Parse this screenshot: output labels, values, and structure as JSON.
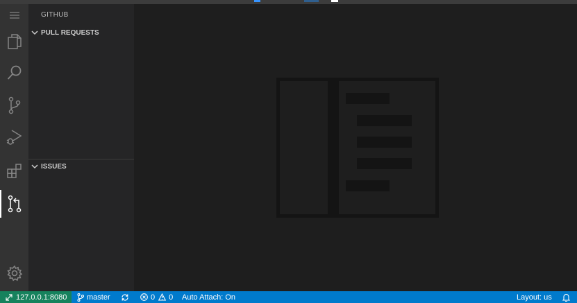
{
  "sidebar": {
    "title": "GITHUB",
    "sections": [
      {
        "label": "PULL REQUESTS",
        "expanded": true
      },
      {
        "label": "ISSUES",
        "expanded": true
      }
    ]
  },
  "activity_bar": {
    "items": [
      {
        "icon": "menu-icon"
      },
      {
        "icon": "explorer-icon"
      },
      {
        "icon": "search-icon"
      },
      {
        "icon": "source-control-icon"
      },
      {
        "icon": "run-debug-icon"
      },
      {
        "icon": "extensions-icon"
      },
      {
        "icon": "pull-request-icon",
        "active": true
      },
      {
        "icon": "gear-icon"
      }
    ]
  },
  "editor": {
    "watermark_icon": "editor-watermark-icon"
  },
  "status_bar": {
    "remote": "127.0.0.1:8080",
    "branch": "master",
    "errors": "0",
    "warnings": "0",
    "auto_attach": "Auto Attach: On",
    "layout": "Layout: us"
  },
  "colors": {
    "status_bar": "#007acc",
    "remote_indicator": "#16825d",
    "activity_bar": "#333333",
    "sidebar": "#252526",
    "editor": "#1e1e1e"
  }
}
